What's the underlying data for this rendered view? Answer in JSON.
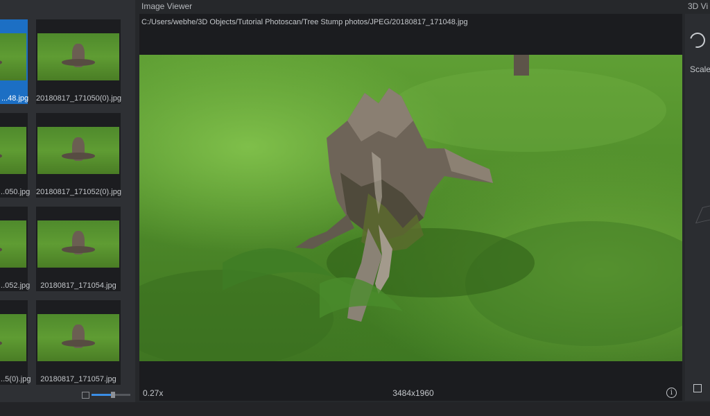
{
  "gallery": {
    "thumbnails": [
      {
        "label": "...48.jpg",
        "selected": true
      },
      {
        "label": "20180817_171050(0).jpg",
        "selected": false
      },
      {
        "label": "...050.jpg",
        "selected": false
      },
      {
        "label": "20180817_171052(0).jpg",
        "selected": false
      },
      {
        "label": "...052.jpg",
        "selected": false
      },
      {
        "label": "20180817_171054.jpg",
        "selected": false
      },
      {
        "label": "...5(0).jpg",
        "selected": false
      },
      {
        "label": "20180817_171057.jpg",
        "selected": false
      }
    ],
    "thumb_size_slider": {
      "value": 0.55
    }
  },
  "viewer": {
    "title": "Image Viewer",
    "path": "C:/Users/webhe/3D Objects/Tutorial Photoscan/Tree Stump photos/JPEG/20180817_171048.jpg",
    "zoom": "0.27x",
    "resolution": "3484x1960",
    "info_icon": "info-icon"
  },
  "viewer3d": {
    "title": "3D Vi",
    "scale_label": "Scale",
    "orbit_icon": "orbit-icon"
  },
  "colors": {
    "selection": "#1c6fc4",
    "panel_bg": "#2e3034",
    "viewer_bg": "#1b1c1f",
    "grass": "#5f9f34"
  }
}
